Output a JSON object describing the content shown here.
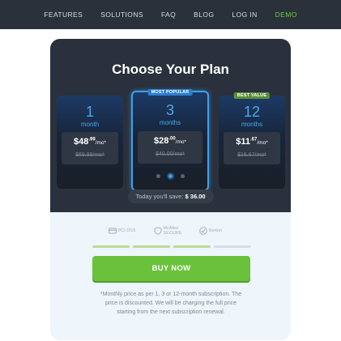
{
  "nav": {
    "items": [
      "FEATURES",
      "SOLUTIONS",
      "FAQ",
      "BLOG",
      "LOG IN",
      "DEMO"
    ],
    "accent_color": "#6ccf3d"
  },
  "card": {
    "title": "Choose Your Plan",
    "plans": [
      {
        "num": "1",
        "unit": "month",
        "price_main": "$48",
        "price_cents": ".99",
        "price_per": "/mo*",
        "old_price": "$69.99/mo*",
        "ribbon": ""
      },
      {
        "num": "3",
        "unit": "months",
        "price_main": "$28",
        "price_cents": ".00",
        "price_per": "/mo*",
        "old_price": "$40.00/mo*",
        "ribbon": "MOST POPULAR",
        "ribbon_color": "#2a7fd1"
      },
      {
        "num": "12",
        "unit": "months",
        "price_main": "$11",
        "price_cents": ".67",
        "price_per": "/mo*",
        "old_price": "$16.67/mo*",
        "ribbon": "BEST VALUE",
        "ribbon_color": "#5b8f3a"
      }
    ],
    "carousel_active_index": 1,
    "savings_label": "Today you'll save:",
    "savings_value": "$ 36.00",
    "badges": [
      "PCI DSS",
      "McAfee SECURE",
      "Norton"
    ],
    "progress_segments_filled": 3,
    "progress_segments_total": 4,
    "buy_label": "BUY NOW",
    "buy_color": "#6ac13b",
    "note": "*Monthly price as per 1, 3 or 12-month subscription. The price is discounted. We will be charging the full price starting from the next subscription renewal."
  }
}
